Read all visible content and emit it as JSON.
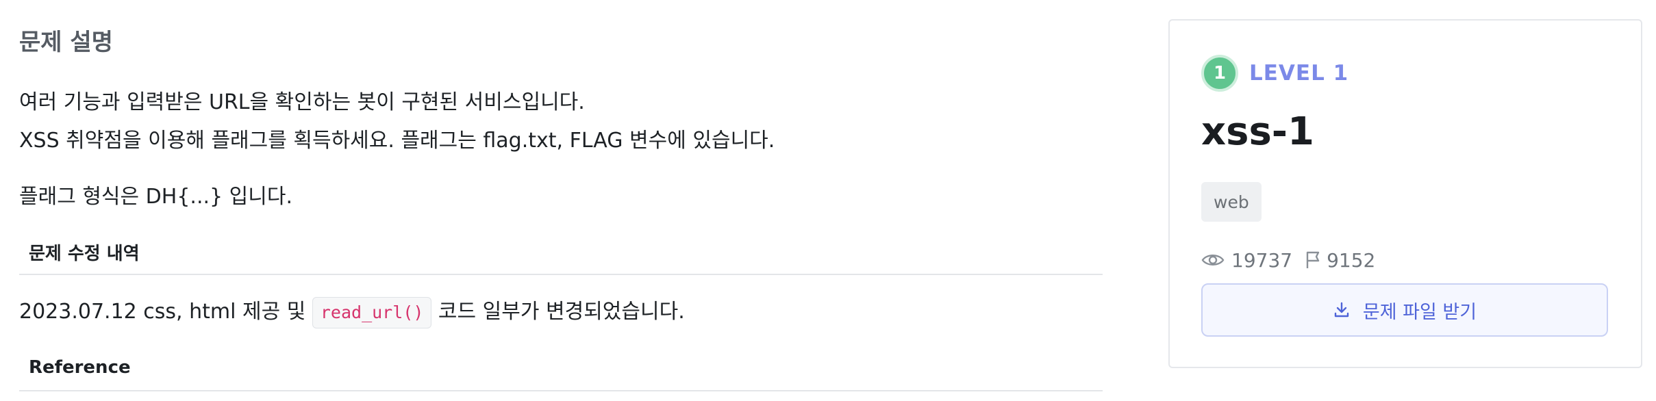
{
  "description": {
    "section_title": "문제 설명",
    "line1": "여러 기능과 입력받은 URL을 확인하는 봇이 구현된 서비스입니다.",
    "line2": "XSS 취약점을 이용해 플래그를 획득하세요. 플래그는 flag.txt, FLAG 변수에 있습니다.",
    "line3": "플래그 형식은 DH{...} 입니다."
  },
  "changes": {
    "title": "문제 수정 내역",
    "text_before": "2023.07.12 css, html 제공 및 ",
    "code": "read_url()",
    "text_after": " 코드 일부가 변경되었습니다."
  },
  "reference": {
    "title": "Reference"
  },
  "card": {
    "level_number": "1",
    "level_label": "LEVEL 1",
    "title": "xss-1",
    "tag": "web",
    "views": "19737",
    "solves": "9152",
    "download_label": "문제 파일 받기",
    "accent_color": "#7b89e8",
    "level_color": "#5fc58f"
  }
}
